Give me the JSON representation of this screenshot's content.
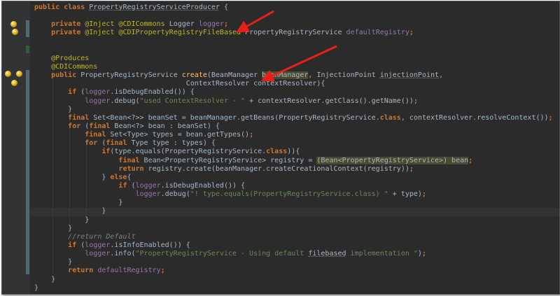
{
  "editor": {
    "lines": [
      [
        [
          "kw",
          "public class "
        ],
        [
          "ul",
          "PropertyRegistryServiceProducer"
        ],
        [
          "p",
          " {"
        ]
      ],
      [],
      [
        [
          "p",
          "    "
        ],
        [
          "kw",
          "private "
        ],
        [
          "ann",
          "@Inject @CDICommons "
        ],
        [
          "p",
          "Logger "
        ],
        [
          "field",
          "logger"
        ],
        [
          "kw",
          ";"
        ]
      ],
      [
        [
          "p",
          "    "
        ],
        [
          "kw",
          "private "
        ],
        [
          "ann",
          "@Inject @CDIPropertyRegistryFileBased "
        ],
        [
          "p",
          "PropertyRegistryService "
        ],
        [
          "field",
          "defaultRegistry"
        ],
        [
          "kw",
          ";"
        ]
      ],
      [],
      [],
      [
        [
          "p",
          "    "
        ],
        [
          "ann",
          "@Produces"
        ]
      ],
      [
        [
          "p",
          "    "
        ],
        [
          "ann",
          "@CDICommons"
        ]
      ],
      [
        [
          "p",
          "    "
        ],
        [
          "kw",
          "public "
        ],
        [
          "p",
          "PropertyRegistryService "
        ],
        [
          "meth",
          "create"
        ],
        [
          "p",
          "(BeanManager "
        ],
        [
          "hl",
          "beanManager"
        ],
        [
          "kw",
          ", "
        ],
        [
          "p",
          "InjectionPoint "
        ],
        [
          "ul",
          "injectionPoint"
        ],
        [
          "kw",
          ","
        ]
      ],
      [
        [
          "p",
          "                                    ContextResolver contextResolver){"
        ]
      ],
      [
        [
          "p",
          "        "
        ],
        [
          "kw",
          "if "
        ],
        [
          "p",
          "("
        ],
        [
          "field",
          "logger"
        ],
        [
          "p",
          ".isDebugEnabled()) {"
        ]
      ],
      [
        [
          "p",
          "            "
        ],
        [
          "field",
          "logger"
        ],
        [
          "p",
          ".debug("
        ],
        [
          "str",
          "\"used ContextResolver - \" "
        ],
        [
          "p",
          "+ contextResolver.getClass().getName())"
        ],
        [
          "kw",
          ";"
        ]
      ],
      [
        [
          "p",
          "        }"
        ]
      ],
      [
        [
          "p",
          "        "
        ],
        [
          "kw",
          "final "
        ],
        [
          "p",
          "Set<Bean<?>> beanSet = beanManager.getBeans(PropertyRegistryService."
        ],
        [
          "kw",
          "class"
        ],
        [
          "kw",
          ", "
        ],
        [
          "p",
          "contextResolver.resolveContext())"
        ],
        [
          "kw",
          ";"
        ]
      ],
      [
        [
          "p",
          "        "
        ],
        [
          "kw",
          "for "
        ],
        [
          "p",
          "("
        ],
        [
          "kw",
          "final "
        ],
        [
          "p",
          "Bean<?> bean : beanSet) {"
        ]
      ],
      [
        [
          "p",
          "            "
        ],
        [
          "kw",
          "final "
        ],
        [
          "p",
          "Set<Type> types = bean.getTypes()"
        ],
        [
          "kw",
          ";"
        ]
      ],
      [
        [
          "p",
          "            "
        ],
        [
          "kw",
          "for "
        ],
        [
          "p",
          "("
        ],
        [
          "kw",
          "final "
        ],
        [
          "p",
          "Type type : types) {"
        ]
      ],
      [
        [
          "p",
          "                "
        ],
        [
          "kw",
          "if"
        ],
        [
          "p",
          "(type.equals(PropertyRegistryService."
        ],
        [
          "kw",
          "class"
        ],
        [
          "p",
          "))"
        ],
        [
          "p",
          "{"
        ]
      ],
      [
        [
          "p",
          "                    "
        ],
        [
          "kw",
          "final "
        ],
        [
          "p",
          "Bean<PropertyRegistryService> registry = "
        ],
        [
          "hl",
          "(Bean<PropertyRegistryService>) bean"
        ],
        [
          "kw",
          ";"
        ]
      ],
      [
        [
          "p",
          "                    "
        ],
        [
          "kw",
          "return "
        ],
        [
          "p",
          "registry.create(beanManager.createCreationalContext(registry))"
        ],
        [
          "kw",
          ";"
        ]
      ],
      [
        [
          "p",
          "                } "
        ],
        [
          "kw",
          "else"
        ],
        [
          "p",
          "{"
        ]
      ],
      [
        [
          "p",
          "                    "
        ],
        [
          "kw",
          "if "
        ],
        [
          "p",
          "("
        ],
        [
          "field",
          "logger"
        ],
        [
          "p",
          ".isDebugEnabled()) {"
        ]
      ],
      [
        [
          "p",
          "                        "
        ],
        [
          "field",
          "logger"
        ],
        [
          "p",
          ".debug("
        ],
        [
          "str",
          "\"! type.equals(PropertyRegistryService.class) \" "
        ],
        [
          "p",
          "+ type)"
        ],
        [
          "kw",
          ";"
        ]
      ],
      [
        [
          "p",
          "                    }"
        ]
      ],
      [
        [
          "p",
          "                }"
        ]
      ],
      [
        [
          "p",
          "            }"
        ]
      ],
      [
        [
          "p",
          "        }"
        ]
      ],
      [
        [
          "p",
          "        "
        ],
        [
          "cmt",
          "//return Default"
        ]
      ],
      [
        [
          "p",
          "        "
        ],
        [
          "kw",
          "if "
        ],
        [
          "p",
          "("
        ],
        [
          "field",
          "logger"
        ],
        [
          "p",
          ".isInfoEnabled()) {"
        ]
      ],
      [
        [
          "p",
          "            "
        ],
        [
          "field",
          "logger"
        ],
        [
          "p",
          ".info("
        ],
        [
          "str",
          "\"PropertyRegistryService - Using default "
        ],
        [
          "ul",
          "filebased"
        ],
        [
          "str",
          " implementation \""
        ],
        [
          "p",
          ")"
        ],
        [
          "kw",
          ";"
        ]
      ],
      [
        [
          "p",
          "        }"
        ]
      ],
      [
        [
          "p",
          "        "
        ],
        [
          "kw",
          "return "
        ],
        [
          "field",
          "defaultRegistry"
        ],
        [
          "kw",
          ";"
        ]
      ],
      [
        [
          "p",
          "    }"
        ]
      ],
      [
        [
          "p",
          "}"
        ]
      ]
    ],
    "current_line": 24
  },
  "colors": {
    "background": "#2b2b2b",
    "keyword": "#cc7832",
    "annotation": "#bbb529",
    "field": "#9876aa",
    "string": "#6a8759",
    "annotation_arrow": "#e8201a"
  },
  "gutter_icons": [
    "injection-bean-icon",
    "injection-bean-icon",
    "injection-bean-icon",
    "injection-bean-icon",
    "injection-bean-icon"
  ]
}
